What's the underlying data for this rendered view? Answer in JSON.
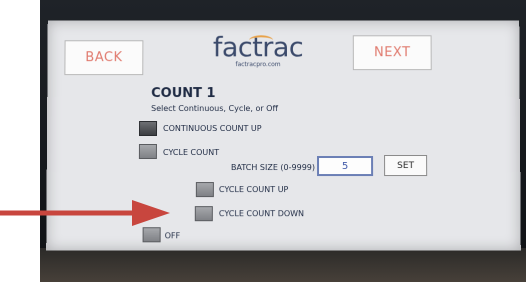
{
  "header": {
    "back_label": "BACK",
    "next_label": "NEXT",
    "logo_text": "factrac",
    "logo_subtext": "factracpro.com"
  },
  "section": {
    "title": "COUNT 1",
    "subtitle": "Select Continuous, Cycle, or Off"
  },
  "options": {
    "continuous_label": "CONTINUOUS COUNT UP",
    "cycle_label": "CYCLE COUNT",
    "cycle_up_label": "CYCLE COUNT UP",
    "cycle_down_label": "CYCLE COUNT DOWN",
    "off_label": "OFF"
  },
  "batch": {
    "label": "BATCH SIZE (0-9999)",
    "value": "5",
    "set_label": "SET"
  },
  "colors": {
    "accent_text": "#e07a6e",
    "arrow": "#c8463e",
    "logo": "#3b4a6b"
  }
}
